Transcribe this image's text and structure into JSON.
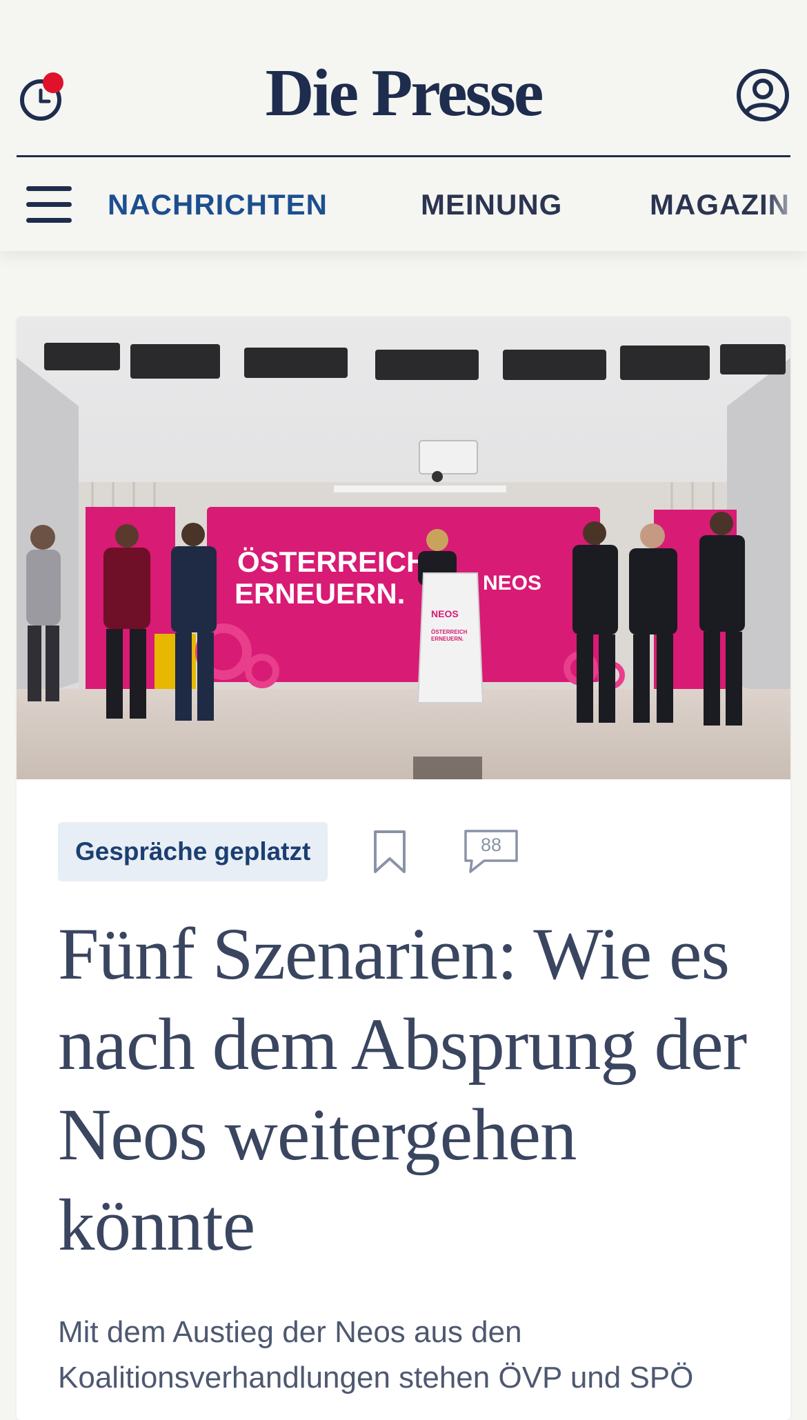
{
  "header": {
    "logo_text": "Die Presse",
    "history_icon": "clock-icon",
    "notification_dot": true,
    "account_icon": "user-circle-icon",
    "brand_color": "#1e2d4d"
  },
  "nav": {
    "menu_icon": "hamburger-menu-icon",
    "items": [
      {
        "label": "NACHRICHTEN",
        "active": true
      },
      {
        "label": "MEINUNG",
        "active": false
      },
      {
        "label": "MAGAZIN",
        "active": false
      }
    ],
    "active_color": "#1c4f8f"
  },
  "article": {
    "kicker": "Gespräche geplatzt",
    "bookmark_icon": "bookmark-icon",
    "comment_icon": "comment-bubble-icon",
    "comment_count": "88",
    "headline": "Fünf Szenarien: Wie es nach dem Absprung der Neos weitergehen könnte",
    "lead": "Mit dem Austieg der Neos aus den Koalitionsverhandlungen stehen ÖVP und SPÖ",
    "hero_image": {
      "backdrop_text_line1": "ÖSTERREICH",
      "backdrop_text_line2": "ERNEUERN.",
      "backdrop_brand": "NEOS",
      "podium_brand": "NEOS",
      "podium_text_line1": "ÖSTERREICH",
      "podium_text_line2": "ERNEUERN.",
      "accent_color": "#d81b74"
    }
  }
}
